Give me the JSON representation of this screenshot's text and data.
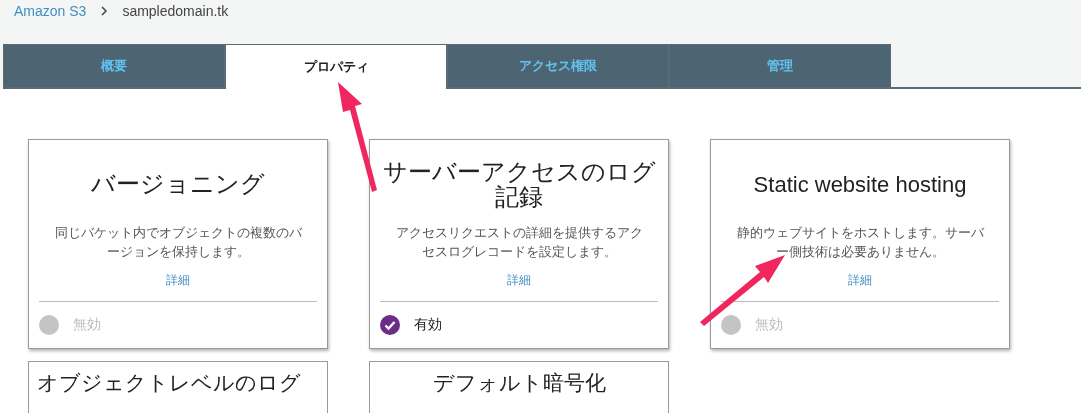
{
  "breadcrumb": [
    {
      "label": "Amazon S3",
      "kind": "link"
    },
    {
      "label": "sampledomain.tk",
      "kind": "current"
    }
  ],
  "tabs": [
    {
      "label": "概要",
      "selected": false
    },
    {
      "label": "プロパティ",
      "selected": true
    },
    {
      "label": "アクセス権限",
      "selected": false
    },
    {
      "label": "管理",
      "selected": false
    }
  ],
  "cards": [
    {
      "title": "バージョニング",
      "description": "同じバケット内でオブジェクトの複数のバージョンを保持します。",
      "link": "詳細",
      "status": "無効",
      "enabled": false
    },
    {
      "title": "サーバーアクセスのログ記録",
      "description": "アクセスリクエストの詳細を提供するアクセスログレコードを設定します。",
      "link": "詳細",
      "status": "有効",
      "enabled": true
    },
    {
      "title": "Static website hosting",
      "description": "静的ウェブサイトをホストします。サーバー側技術は必要ありません。",
      "link": "詳細",
      "status": "無効",
      "enabled": false
    },
    {
      "title": "オブジェクトレベルのログ"
    },
    {
      "title": "デフォルト暗号化"
    }
  ]
}
